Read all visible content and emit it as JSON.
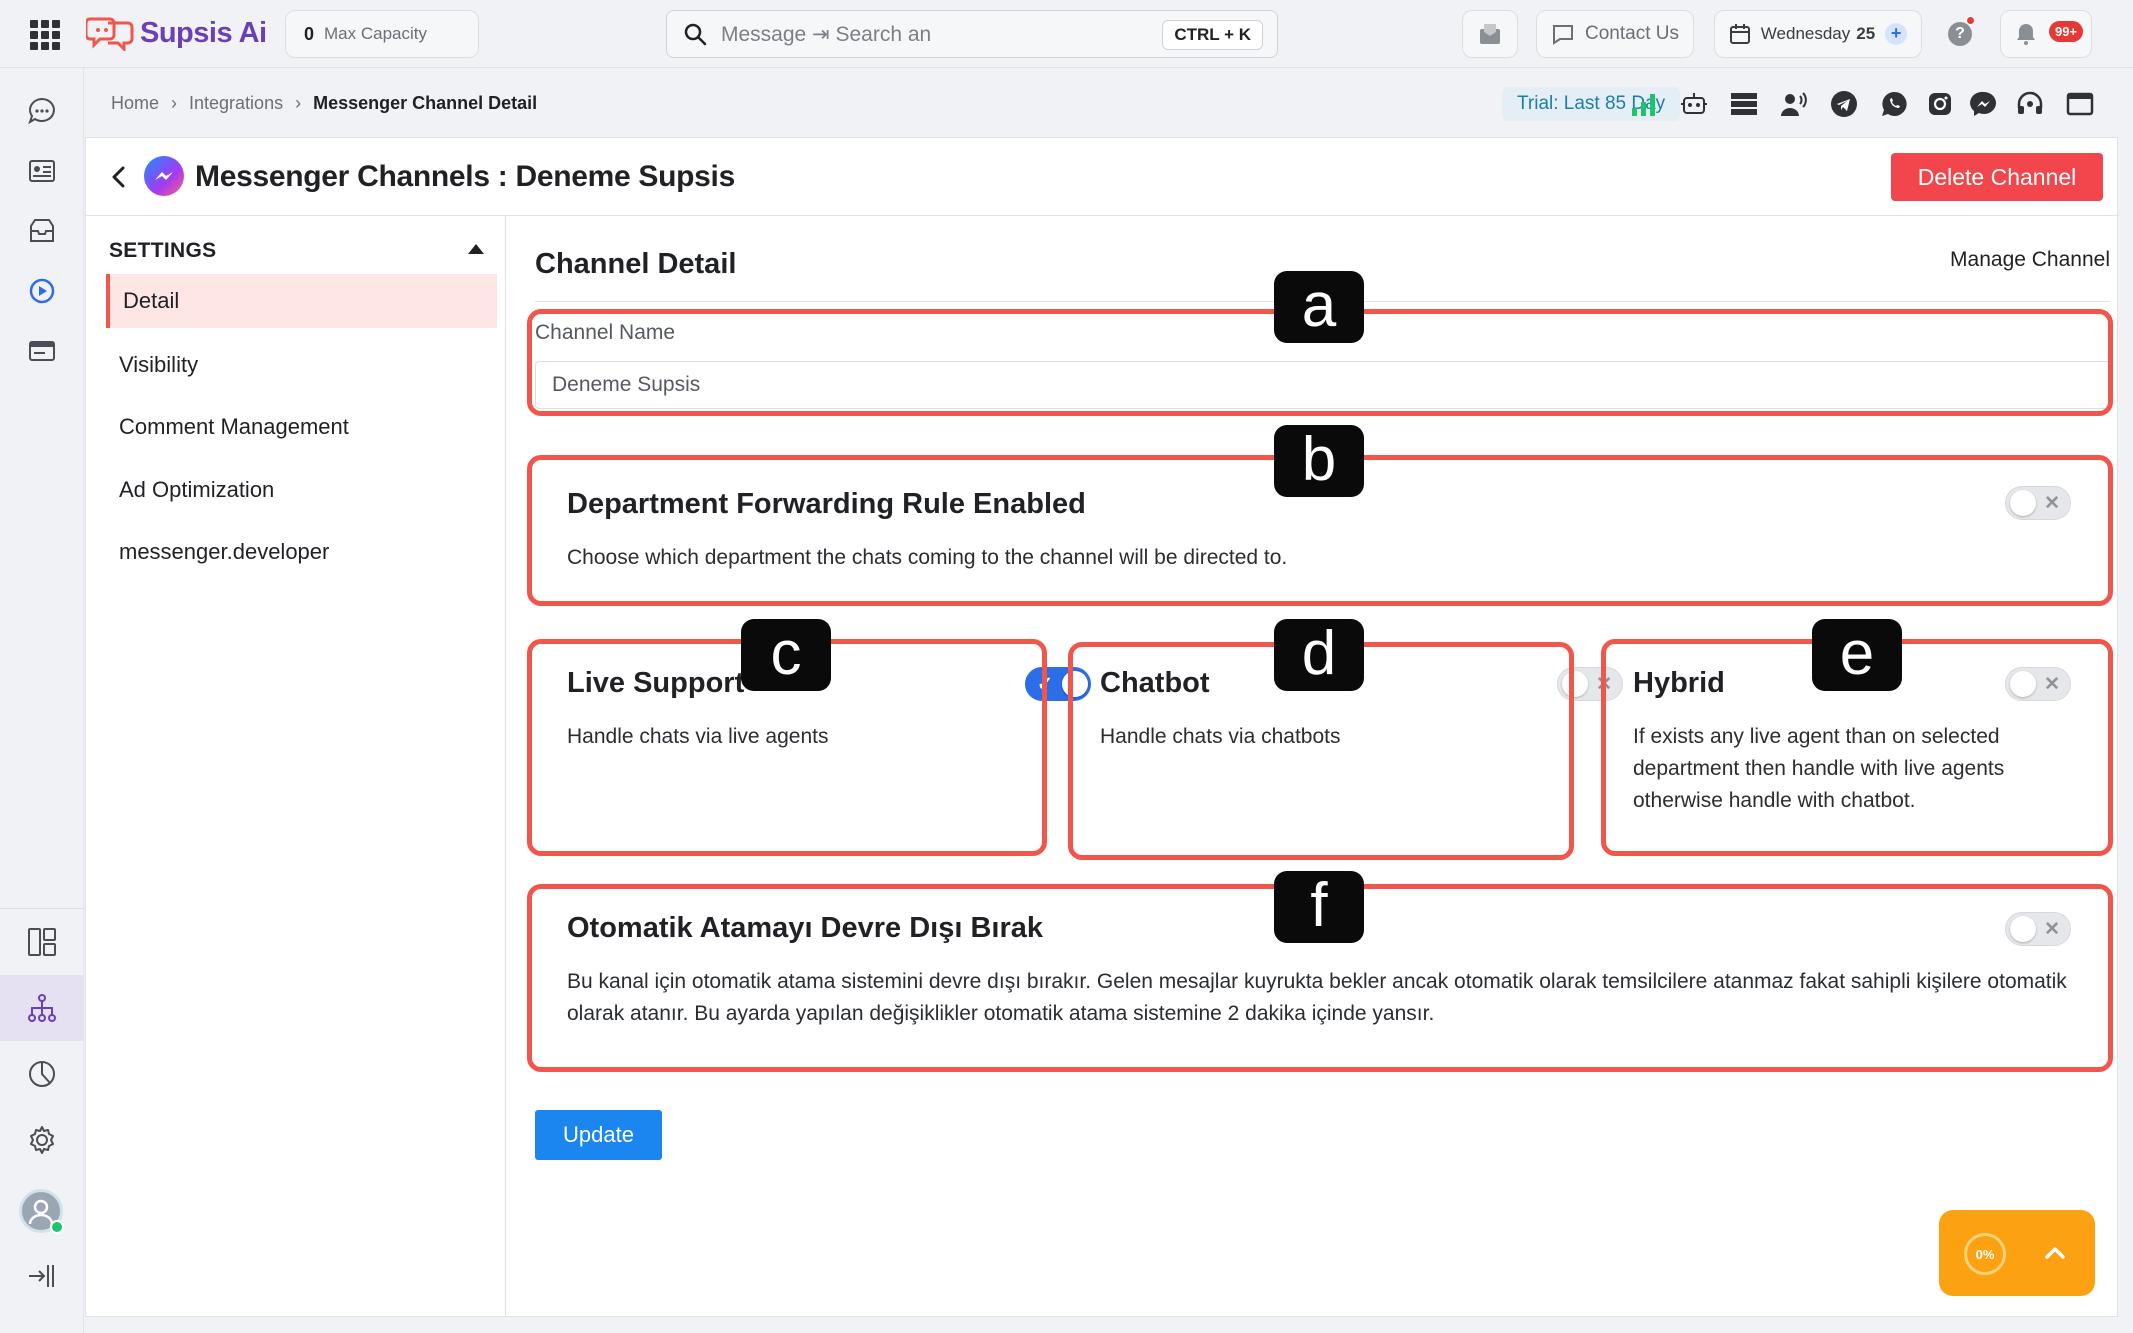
{
  "topbar": {
    "brand": "Supsis Ai",
    "capacity_value": "0",
    "capacity_label": "Max Capacity",
    "search_placeholder": "Message ⇥ Search an",
    "search_shortcut": "CTRL + K",
    "contact_label": "Contact Us",
    "date_day": "Wednesday",
    "date_num": "25",
    "date_plus": "+",
    "help_label": "?",
    "notification_count": "99+"
  },
  "breadcrumb": {
    "items": [
      "Home",
      "Integrations"
    ],
    "separator": "›",
    "current": "Messenger Channel Detail"
  },
  "trial": "Trial: Last 85 Day",
  "channel_icons": [
    "signal-bars-icon",
    "robot-icon",
    "server-icon",
    "broadcast-user-icon",
    "telegram-icon",
    "whatsapp-icon",
    "instagram-icon",
    "messenger-icon",
    "headset-icon",
    "window-icon"
  ],
  "header": {
    "title": "Messenger Channels : Deneme Supsis",
    "delete_label": "Delete Channel"
  },
  "settings": {
    "title": "SETTINGS",
    "items": [
      {
        "label": "Detail",
        "active": true
      },
      {
        "label": "Visibility",
        "active": false
      },
      {
        "label": "Comment Management",
        "active": false
      },
      {
        "label": "Ad Optimization",
        "active": false
      },
      {
        "label": "messenger.developer",
        "active": false
      }
    ]
  },
  "detail": {
    "title": "Channel Detail",
    "manage": "Manage Channel",
    "channel_name_label": "Channel Name",
    "channel_name_value": "Deneme Supsis",
    "forwarding": {
      "title": "Department Forwarding Rule Enabled",
      "desc": "Choose which department the chats coming to the channel will be directed to.",
      "enabled": false
    },
    "live_support": {
      "title": "Live Support",
      "desc": "Handle chats via live agents",
      "enabled": true
    },
    "chatbot": {
      "title": "Chatbot",
      "desc": "Handle chats via chatbots",
      "enabled": false
    },
    "hybrid": {
      "title": "Hybrid",
      "desc": "If exists any live agent than on selected department then handle with live agents otherwise handle with chatbot.",
      "enabled": false
    },
    "auto_assign": {
      "title": "Otomatik Atamayı Devre Dışı Bırak",
      "desc": "Bu kanal için otomatik atama sistemini devre dışı bırakır. Gelen mesajlar kuyrukta bekler ancak otomatik olarak temsilcilere atanmaz fakat sahipli kişilere otomatik olarak atanır. Bu ayarda yapılan değişiklikler otomatik atama sistemine 2 dakika içinde yansır.",
      "enabled": false
    },
    "update_label": "Update"
  },
  "toggle_marks": {
    "on": "✓",
    "off": "✕"
  },
  "annotations": [
    "a",
    "b",
    "c",
    "d",
    "e",
    "f"
  ],
  "widget": {
    "progress": "0%"
  },
  "colors": {
    "accent_red": "#f2464c",
    "annotation_red": "#f0564c",
    "primary_blue": "#1b86f0",
    "brand_purple": "#6b3fb8",
    "widget_orange": "#fba112"
  }
}
